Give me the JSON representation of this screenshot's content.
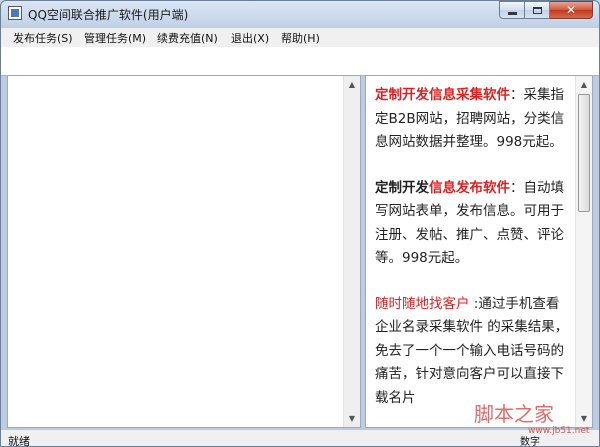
{
  "window": {
    "title": "QQ空间联合推广软件(用户端)"
  },
  "menu": {
    "items": [
      {
        "label": "发布任务(S)"
      },
      {
        "label": "管理任务(M)"
      },
      {
        "label": "续费充值(N)"
      },
      {
        "label": "退出(X)"
      },
      {
        "label": "帮助(H)"
      }
    ]
  },
  "ad": {
    "block1": {
      "title": "定制开发信息采集软件",
      "sep": "：",
      "body": "采集指定B2B网站，招聘网站，分类信息网站数据并整理。998元起。"
    },
    "block2": {
      "prefix": "定制开发",
      "title": "信息发布软件",
      "sep": "：",
      "body": "自动填写网站表单，发布信息。可用于注册、发帖、推广、点赞、评论等。998元起。"
    },
    "block3": {
      "title": "随时随地找客户",
      "body": " :通过手机查看 企业名录采集软件 的采集结果，免去了一个一个输入电话号码的痛苦，针对意向客户可以直接下载名片"
    }
  },
  "status": {
    "text": "就绪",
    "right": "数字"
  },
  "watermark": {
    "text": "脚本之家",
    "url": "www.jb51.net"
  }
}
